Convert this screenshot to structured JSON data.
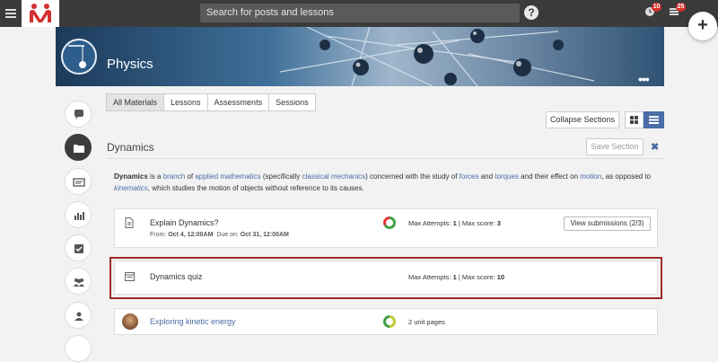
{
  "topbar": {
    "search_placeholder": "Search for posts and lessons",
    "help_label": "?",
    "notifications_count": "10",
    "messages_count": "25",
    "fab_label": "+"
  },
  "course": {
    "title": "Physics",
    "more_label": "•••"
  },
  "tabs": [
    "All Materials",
    "Lessons",
    "Assessments",
    "Sessions"
  ],
  "toolbar": {
    "collapse_label": "Collapse Sections"
  },
  "section": {
    "title": "Dynamics",
    "save_label": "Save Section",
    "close_label": "✖",
    "desc": {
      "term": "Dynamics",
      "t1": " is a ",
      "l1": "branch",
      "t2": " of ",
      "l2": "applied mathematics",
      "t3": " (specifically ",
      "l3": "classical mechanics",
      "t4": ") concerned with the study of ",
      "l4": "forces",
      "t5": " and ",
      "l5": "torques",
      "t6": " and their effect on ",
      "l6": "motion",
      "t7": ", as opposed to ",
      "l7": "kinematics",
      "t8": ", which studies the motion of objects without reference to its causes."
    }
  },
  "items": [
    {
      "title": "Explain Dynamics?",
      "from_label": "From:",
      "from_date": "Oct 4, 12:00AM",
      "due_label": "Due on:",
      "due_date": "Oct 31, 12:00AM",
      "attempts_label": "Max Attempts:",
      "attempts": "1",
      "score_label": "Max score:",
      "score": "3",
      "submissions_label": "View submissions (2/3)",
      "progress": 0.67,
      "colors": {
        "done": "#43a047",
        "rest": "#e53935"
      }
    },
    {
      "title": "Dynamics quiz",
      "attempts_label": "Max Attempts:",
      "attempts": "1",
      "score_label": "Max score:",
      "score": "10"
    },
    {
      "title": "Exploring kinetic energy",
      "pages_label": "2 unit pages",
      "progress": 0.5,
      "colors": {
        "done": "#c0ca33",
        "rest": "#43a047"
      }
    }
  ],
  "colors": {
    "accent": "#4a6da7",
    "topbar": "#3b3b3b",
    "badge": "#d32f2f",
    "highlight": "#9b2c2c"
  }
}
